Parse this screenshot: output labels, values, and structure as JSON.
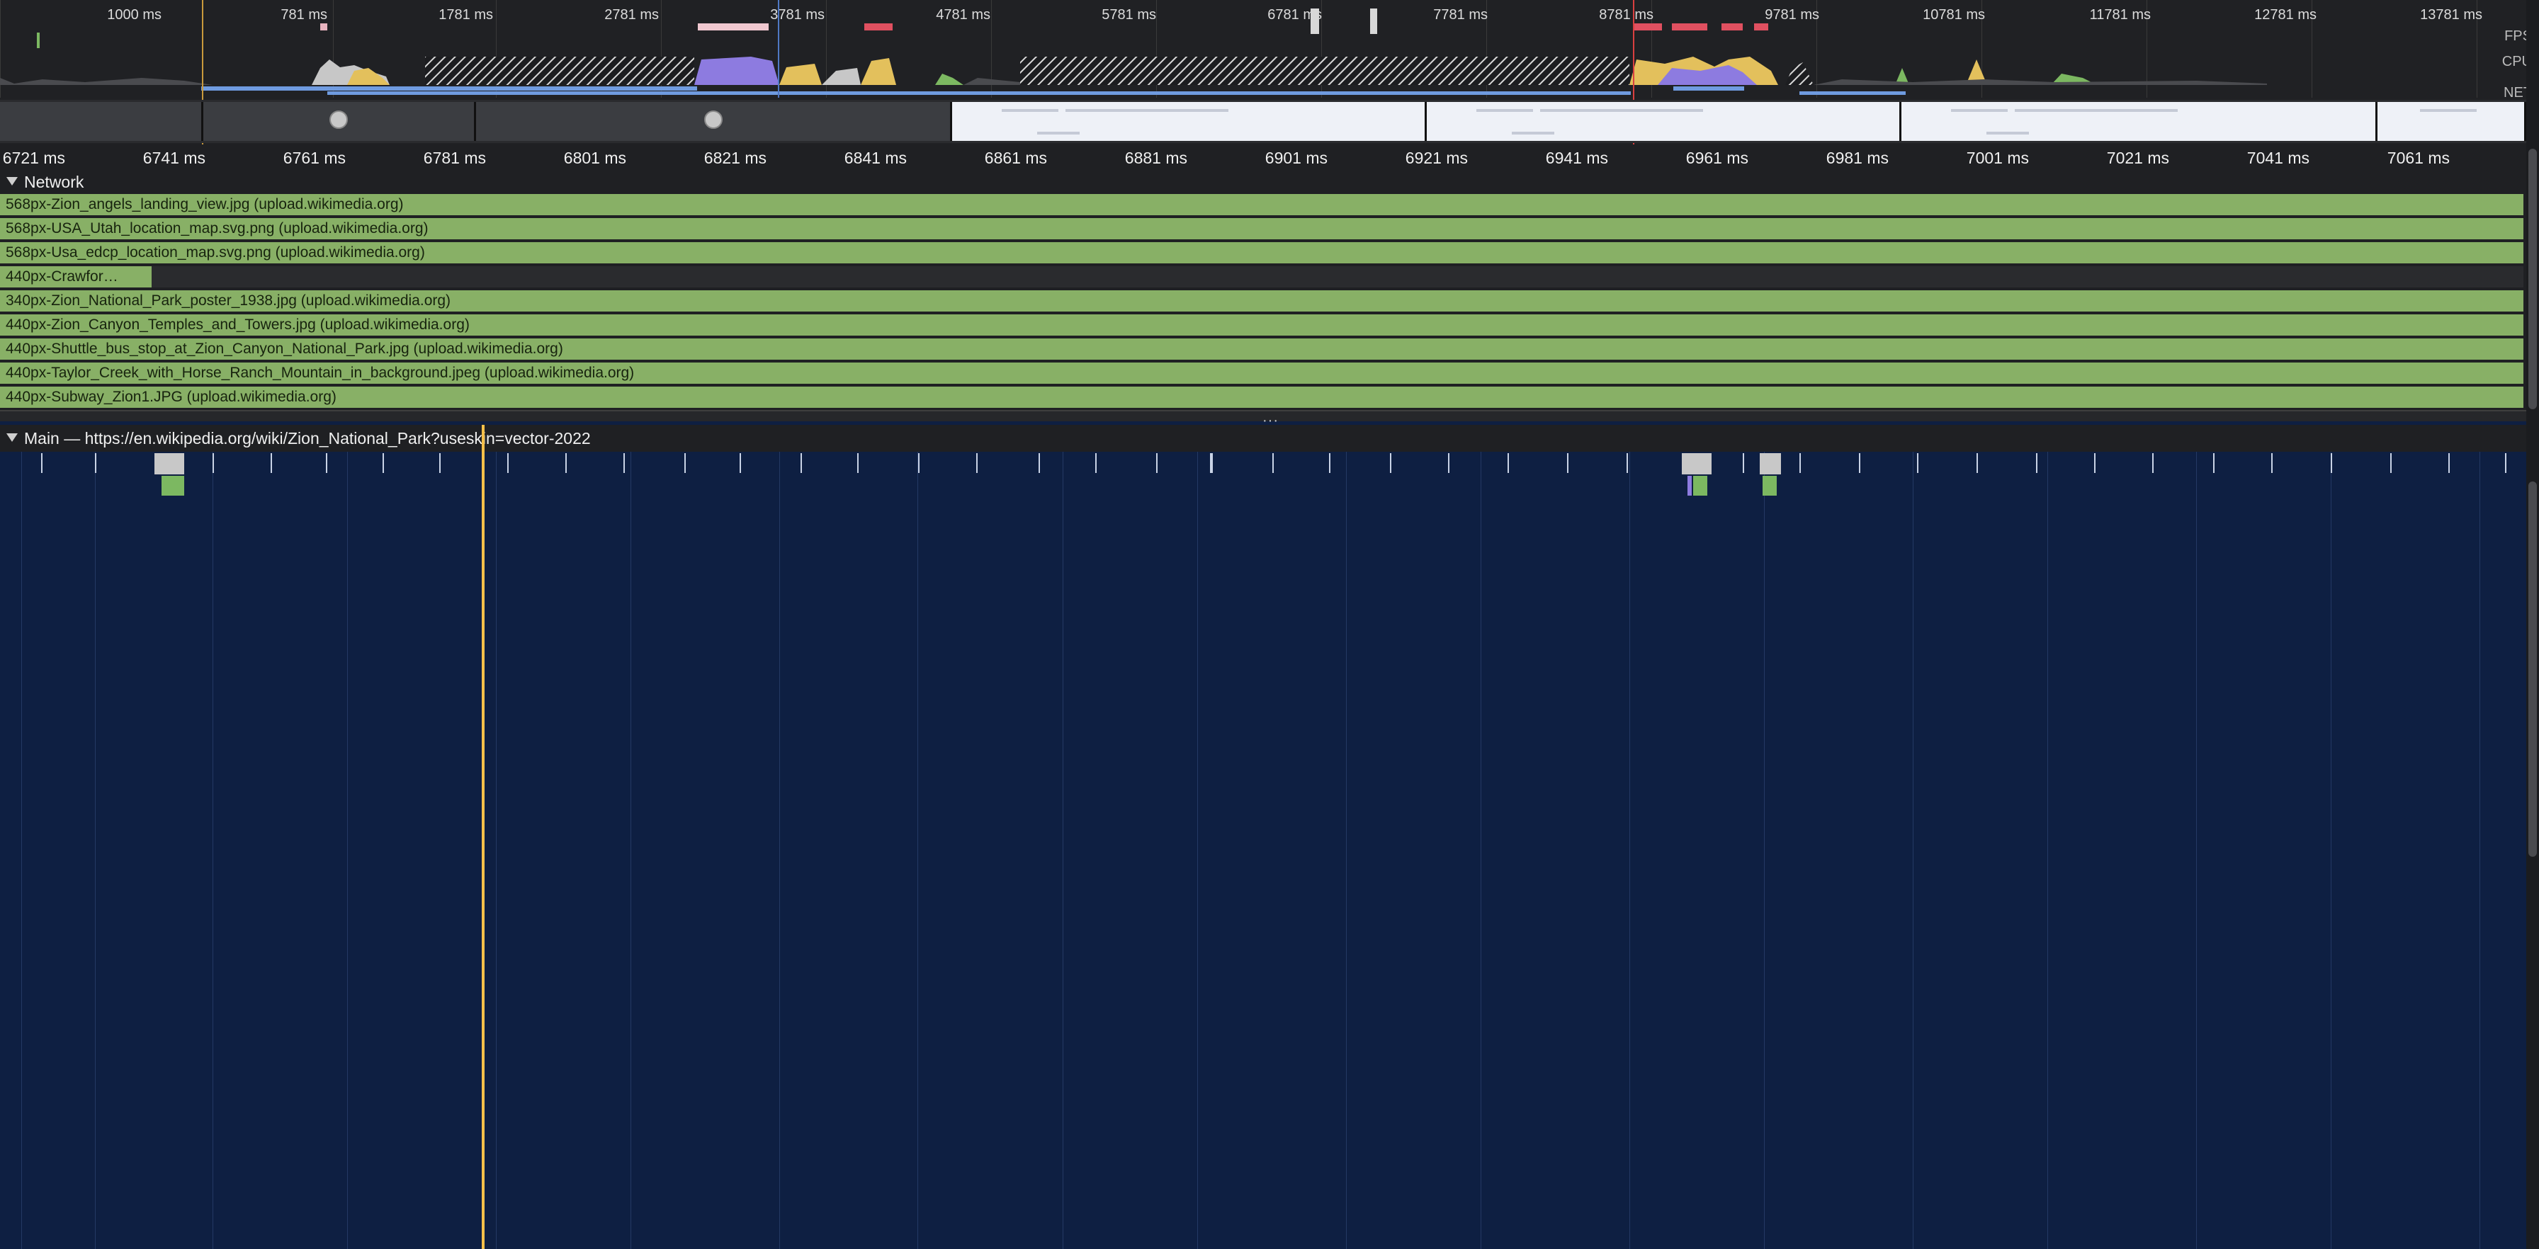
{
  "overview": {
    "tick_labels": [
      "1000 ms",
      "781 ms",
      "1781 ms",
      "2781 ms",
      "3781 ms",
      "4781 ms",
      "5781 ms",
      "6781 ms",
      "7781 ms",
      "8781 ms",
      "9781 ms",
      "10781 ms",
      "11781 ms",
      "12781 ms",
      "13781 ms"
    ],
    "track_labels": {
      "fps": "FPS",
      "cpu": "CPU",
      "net": "NET"
    }
  },
  "ruler": {
    "ticks": [
      "6721 ms",
      "6741 ms",
      "6761 ms",
      "6781 ms",
      "6801 ms",
      "6821 ms",
      "6841 ms",
      "6861 ms",
      "6881 ms",
      "6901 ms",
      "6921 ms",
      "6941 ms",
      "6961 ms",
      "6981 ms",
      "7001 ms",
      "7021 ms",
      "7041 ms",
      "7061 ms"
    ]
  },
  "network": {
    "title": "Network",
    "requests": [
      "568px-Zion_angels_landing_view.jpg (upload.wikimedia.org)",
      "568px-USA_Utah_location_map.svg.png (upload.wikimedia.org)",
      "568px-Usa_edcp_location_map.svg.png (upload.wikimedia.org)",
      "440px-Crawfor…",
      "340px-Zion_National_Park_poster_1938.jpg (upload.wikimedia.org)",
      "440px-Zion_Canyon_Temples_and_Towers.jpg (upload.wikimedia.org)",
      "440px-Shuttle_bus_stop_at_Zion_Canyon_National_Park.jpg (upload.wikimedia.org)",
      "440px-Taylor_Creek_with_Horse_Ranch_Mountain_in_background.jpeg (upload.wikimedia.org)",
      "440px-Subway_Zion1.JPG (upload.wikimedia.org)"
    ]
  },
  "splitter": {
    "handle": "···"
  },
  "main": {
    "title": "Main — https://en.wikipedia.org/wiki/Zion_National_Park?useskin=vector-2022"
  },
  "colors": {
    "background": "#0e1f42",
    "request_bar": "#88b066",
    "playhead": "#f5c04a",
    "cpu_scripting": "#e3c05c",
    "cpu_rendering": "#8d7be0",
    "cpu_painting": "#7cb861"
  }
}
